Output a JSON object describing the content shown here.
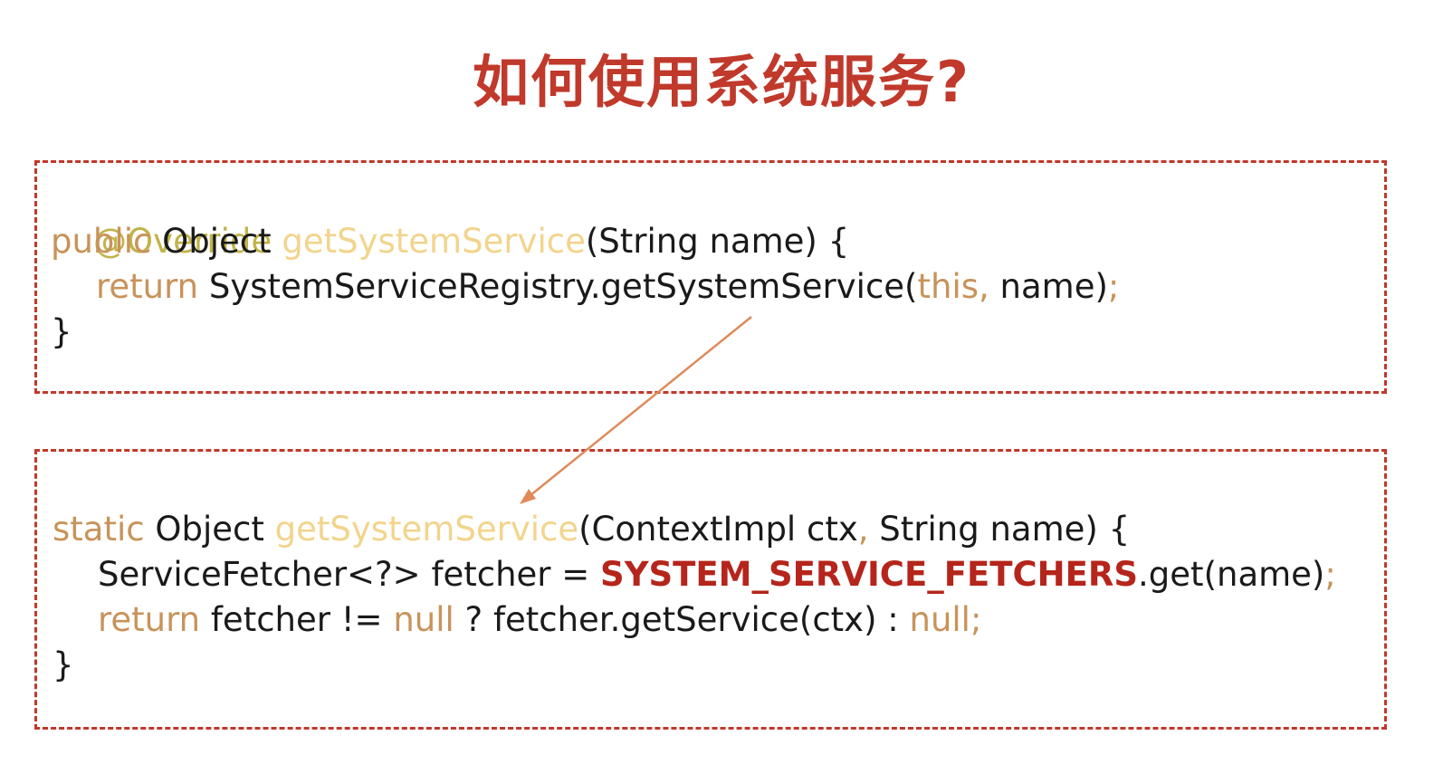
{
  "title": "如何使用系统服务?",
  "block1": {
    "l1": {
      "ann": "@Override"
    },
    "l2": {
      "kw": "public",
      "t1": " Object ",
      "meth": "getSystemService",
      "t2": "(String name) {"
    },
    "l3": {
      "kw": "return",
      "t1": " SystemServiceRegistry.getSystemService(",
      "kw2": "this,",
      "t2": " name)",
      "semi": ";"
    },
    "l4": {
      "t1": "}"
    }
  },
  "block2": {
    "l1": {
      "kw": "static",
      "t1": " Object ",
      "meth": "getSystemService",
      "t2": "(ContextImpl ctx",
      "comma": ",",
      "t3": " String name) {"
    },
    "l2": {
      "t1": "ServiceFetcher<?> fetcher = ",
      "const": "SYSTEM_SERVICE_FETCHERS",
      "t2": ".get(name)",
      "semi": ";"
    },
    "l3": {
      "kw": "return",
      "t1": " fetcher != ",
      "kw2": "null",
      "t2": " ? fetcher.getService(ctx) : ",
      "kw3": "null",
      "semi": ";"
    },
    "l4": {
      "t1": "}"
    }
  },
  "colors": {
    "accent": "#c0392b",
    "keyword": "#c8935a",
    "method": "#f2d48c",
    "annotation": "#c2b34a",
    "arrow": "#e08a5a"
  }
}
